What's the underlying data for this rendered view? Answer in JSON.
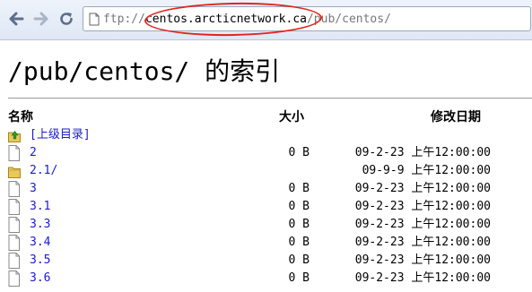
{
  "address_bar": {
    "scheme": "ftp://",
    "host": "centos.arcticnetwork.ca",
    "path": "/pub/centos/"
  },
  "page": {
    "title": "/pub/centos/ 的索引"
  },
  "table": {
    "headers": {
      "name": "名称",
      "size": "大小",
      "modified": "修改日期"
    },
    "parent_link": "[上级目录]",
    "rows": [
      {
        "name": "2",
        "type": "file",
        "size": "0 B",
        "date": "09-2-23",
        "time": "上午12:00:00"
      },
      {
        "name": "2.1/",
        "type": "folder",
        "size": "",
        "date": "09-9-9",
        "time": "上午12:00:00"
      },
      {
        "name": "3",
        "type": "file",
        "size": "0 B",
        "date": "09-2-23",
        "time": "上午12:00:00"
      },
      {
        "name": "3.1",
        "type": "file",
        "size": "0 B",
        "date": "09-2-23",
        "time": "上午12:00:00"
      },
      {
        "name": "3.3",
        "type": "file",
        "size": "0 B",
        "date": "09-2-23",
        "time": "上午12:00:00"
      },
      {
        "name": "3.4",
        "type": "file",
        "size": "0 B",
        "date": "09-2-23",
        "time": "上午12:00:00"
      },
      {
        "name": "3.5",
        "type": "file",
        "size": "0 B",
        "date": "09-2-23",
        "time": "上午12:00:00"
      },
      {
        "name": "3.6",
        "type": "file",
        "size": "0 B",
        "date": "09-2-23",
        "time": "上午12:00:00"
      }
    ]
  },
  "colors": {
    "link": "#1a1ad0",
    "annotation": "#e0261f"
  }
}
